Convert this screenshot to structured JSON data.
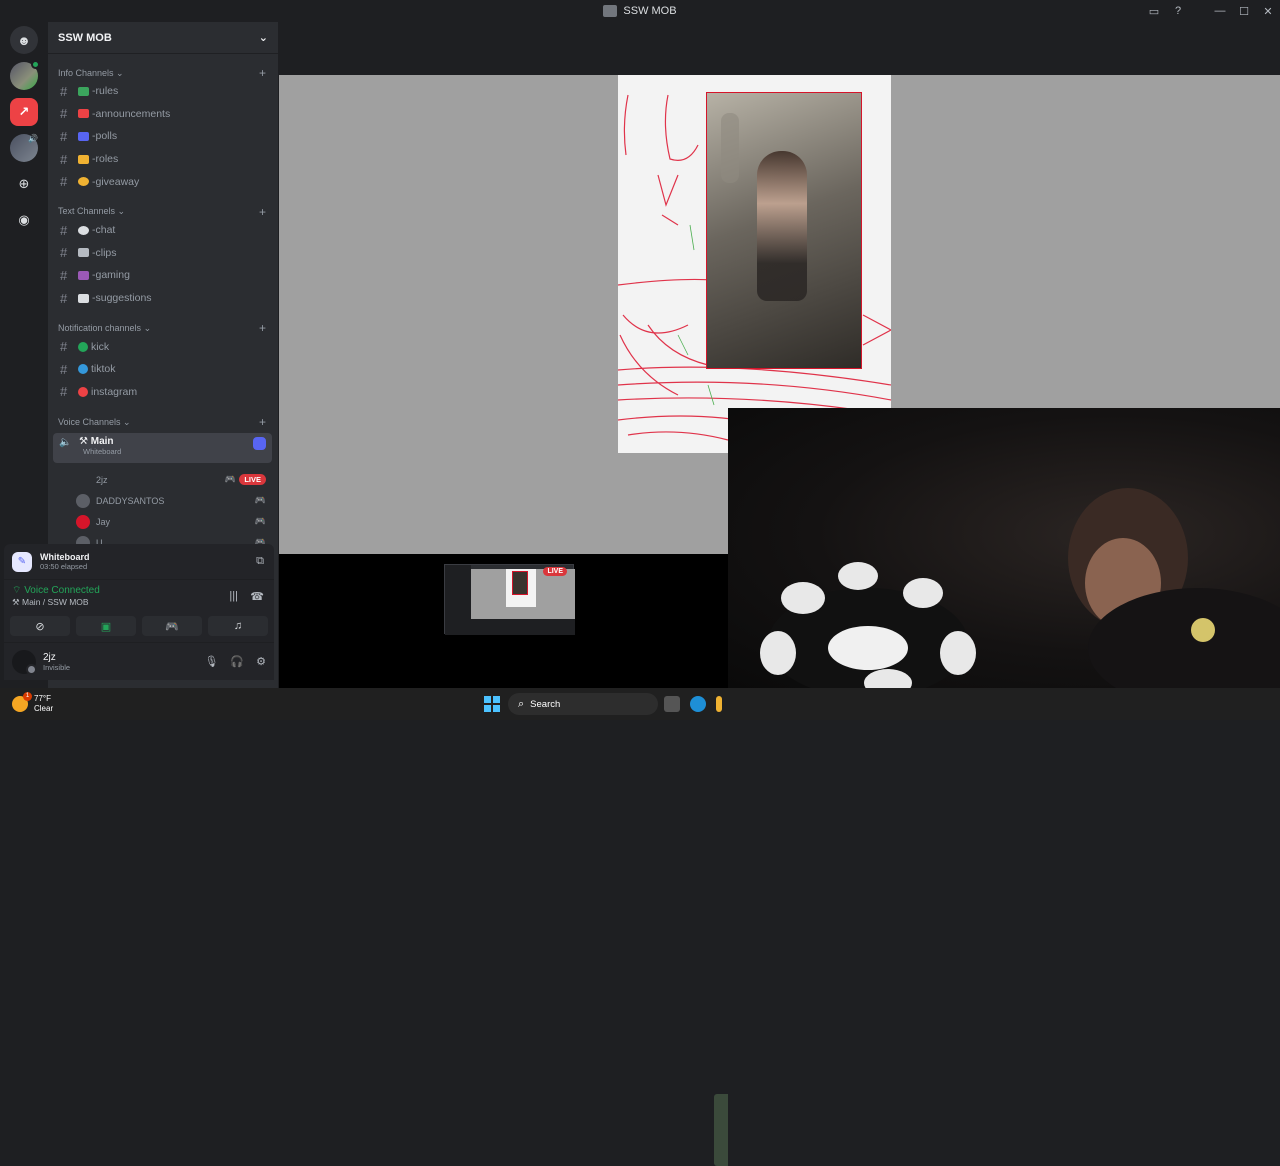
{
  "window": {
    "title": "SSW MOB"
  },
  "server": {
    "name": "SSW MOB"
  },
  "categories": [
    {
      "name": "Info Channels",
      "channels": [
        {
          "name": "-rules",
          "color": "#3ba55d"
        },
        {
          "name": "-announcements",
          "color": "#ed4245"
        },
        {
          "name": "-polls",
          "color": "#5865f2"
        },
        {
          "name": "-roles",
          "color": "#f0b232"
        },
        {
          "name": "-giveaway",
          "color": "#f0b232"
        }
      ]
    },
    {
      "name": "Text Channels",
      "channels": [
        {
          "name": "-chat",
          "color": "#dbdee1"
        },
        {
          "name": "-clips",
          "color": "#b5bac1"
        },
        {
          "name": "-gaming",
          "color": "#9b59b6"
        },
        {
          "name": "-suggestions",
          "color": "#dbdee1"
        }
      ]
    },
    {
      "name": "Notification channels",
      "channels": [
        {
          "name": "kick",
          "color": "#23a559"
        },
        {
          "name": "tiktok",
          "color": "#3498db"
        },
        {
          "name": "instagram",
          "color": "#ed4245"
        }
      ]
    },
    {
      "name": "Voice Channels",
      "channels": []
    }
  ],
  "voice": {
    "channel": "Main",
    "activity": "Whiteboard",
    "users": [
      {
        "name": "2jz",
        "live": "LIVE"
      },
      {
        "name": "DADDYSANTOS"
      },
      {
        "name": "Jay"
      },
      {
        "name": "U..."
      }
    ]
  },
  "panel": {
    "activity_title": "Whiteboard",
    "activity_elapsed": "03:50 elapsed",
    "status": "Voice Connected",
    "location": "Main / SSW MOB",
    "username": "2jz",
    "user_status": "Invisible"
  },
  "stream": {
    "thumb_live": "LIVE"
  },
  "taskbar": {
    "temp": "77°F",
    "condition": "Clear",
    "search": "Search"
  }
}
